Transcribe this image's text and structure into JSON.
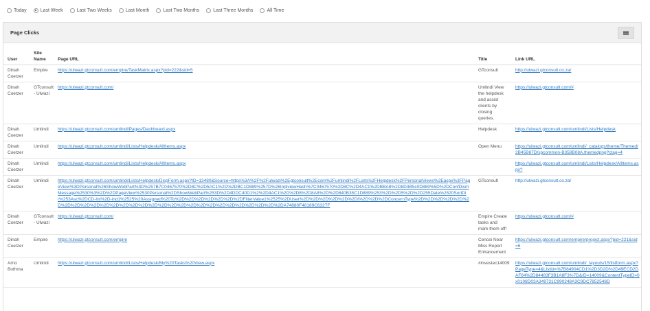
{
  "filters": [
    {
      "label": "Today",
      "checked": false
    },
    {
      "label": "Last Week",
      "checked": true
    },
    {
      "label": "Last Two Weeks",
      "checked": false
    },
    {
      "label": "Last Month",
      "checked": false
    },
    {
      "label": "Last Two Months",
      "checked": false
    },
    {
      "label": "Last Three Months",
      "checked": false
    },
    {
      "label": "All Time",
      "checked": false
    }
  ],
  "panel": {
    "title": "Page Clicks",
    "menu_icon": "list-icon"
  },
  "table": {
    "headers": {
      "user": "User",
      "site": "Site Name",
      "page_url": "Page URL",
      "title": "Title",
      "link_url": "Link URL"
    },
    "rows": [
      {
        "user": "Dinah Coetzer",
        "site": "Empire",
        "page_url": "https://ulwazi.gtconsult.com/empire/TaskMatrix.aspx?pid=222&sid=5",
        "title": "GTconsult",
        "link_url": "http://ulwazi.gtconsult.co.za/"
      },
      {
        "user": "Dinah Coetzer",
        "site": "GTconsult - Ulwazi",
        "page_url": "https://ulwazi.gtconsult.com/",
        "title": "Umlindi View the helpdesk and assist clients by closing queries.",
        "link_url": "https://ulwazi.gtconsult.com/#"
      },
      {
        "user": "Dinah Coetzer",
        "site": "Umlindi",
        "page_url": "https://ulwazi.gtconsult.com/umlindi/Pages/Dashboard.aspx",
        "title": "Helpdesk",
        "link_url": "https://ulwazi.gtconsult.com/umlindi/Lists/Helpdesk"
      },
      {
        "user": "Dinah Coetzer",
        "site": "Umlindi",
        "page_url": "https://ulwazi.gtconsult.com/umlindi/Lists/Helpdesk/AllItems.aspx",
        "title": "Open Menu",
        "link_url": "https://ulwazi.gtconsult.com/umlindi/_catalogs/theme/Themed/2B45B87D/spcommon-B358B08A.themedpng?ctag=4"
      },
      {
        "user": "Dinah Coetzer",
        "site": "Umlindi",
        "page_url": "https://ulwazi.gtconsult.com/umlindi/Lists/Helpdesk/AllItems.aspx",
        "title": "",
        "link_url": "https://ulwazi.gtconsult.com/umlindi/Lists/Helpdesk/AllItems.aspx?"
      },
      {
        "user": "Dinah Coetzer",
        "site": "Umlindi",
        "page_url": "https://ulwazi.gtconsult.com/umlindi/Lists/Helpdesk/DispForm.aspx?ID=13480&Source=https%3A%2F%2Fulwazi%2Egtconsult%2Ecom%2Fumlindi%2FLists%2FHelpdesk%2FPersonalViews%2Easpx%3FPageView%3DPersonal%26ShowWebPart%3D%257B7C0467570%2D8C%2D5AC1%2D%2DBC1D889%257D%26InplviewHash%7C0467570%2D8C%2D4AC1%2DBBA8%2D8D3B5c0D889%5D%2DConfDismMessage%2530%3%2D%2DPageView%2530Personal%2DShowWebPart%253D%2D4DDC40D1%2%2D4AC1%2D%2D8%2D8A8%2D%2D840B35C1D889%253%2D%2D5%2D%2D255Date%2520SortDir%253Asc%2DCD-Int%2D-ind1%2525%20Assigned%20To%2D%2D%2D%2D%2D%2D%2DFilterValue1%2525%2DUser%2D%2D%2D%2D%2D%2Dt%2D%2D%2DConcernType%2D%2D%2D%2D%2D%2D%2D%2D%2D%2D%2D%2D%2D%2D%2D%2D%2D%2D%2D%2D%2D%2D%2D%2D%2D%2D%2D%2D%2DA74880F48189C6327F",
        "title": "GTconsult",
        "link_url": "http://ulwazi.gtconsult.co.za/"
      },
      {
        "user": "Dinah Coetzer",
        "site": "GTconsult - Ulwazi",
        "page_url": "https://ulwazi.gtconsult.com/",
        "title": "Empire Create tasks and mark them off!",
        "link_url": "https://ulwazi.gtconsult.com/#"
      },
      {
        "user": "Dinah Coetzer",
        "site": "Empire",
        "page_url": "https://ulwazi.gtconsult.com/empire",
        "title": "Cencei Near Miss Report Enhancement",
        "link_url": "https://ulwazi.gtconsult.com/empire/project.aspx?pid=221&sid=6"
      },
      {
        "user": "Arno Bothma",
        "site": "Umlindi",
        "page_url": "https://ulwazi.gtconsult.com/umlindi/Lists/Helpdesk/My%20Tasks%20View.aspx",
        "title": "#investec14009",
        "link_url": "https://ulwazi.gtconsult.com/umlindi/_layouts/15/listform.aspx?PageType=4&ListId=%7B84904CD1%2D3D2D%2D49ECD2DAF64%2D84483F3B1A8F3%7D&ID=14009&ContentTypeID=0x0108D03A349731C990248A3C9DC7852548D"
      }
    ]
  }
}
